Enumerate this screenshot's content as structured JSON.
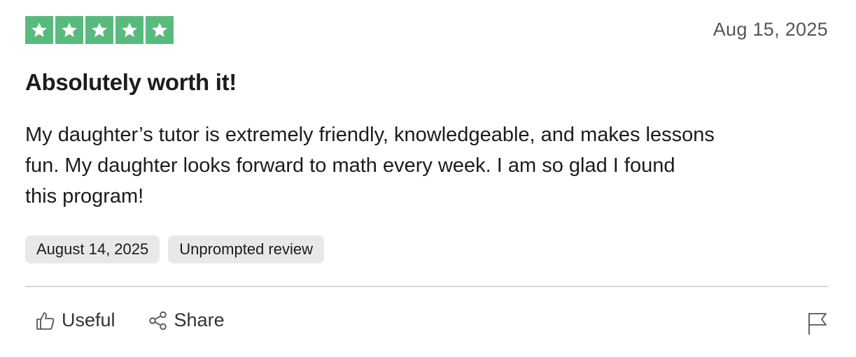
{
  "rating": {
    "stars_filled": 5,
    "stars_total": 5,
    "color": "#58bb7d"
  },
  "review": {
    "date": "Aug 15, 2025",
    "title": "Absolutely worth it!",
    "body_lines": [
      "My daughter’s tutor is extremely friendly, knowledgeable, and makes lessons",
      "fun. My daughter looks forward to math every week. I am so glad I found",
      "this program!"
    ]
  },
  "tags": {
    "experience_date": "August 14, 2025",
    "review_type": "Unprompted review"
  },
  "actions": {
    "useful_label": "Useful",
    "useful_icon": "thumbs-up-icon",
    "share_label": "Share",
    "share_icon": "share-icon",
    "report_icon": "flag-icon"
  }
}
